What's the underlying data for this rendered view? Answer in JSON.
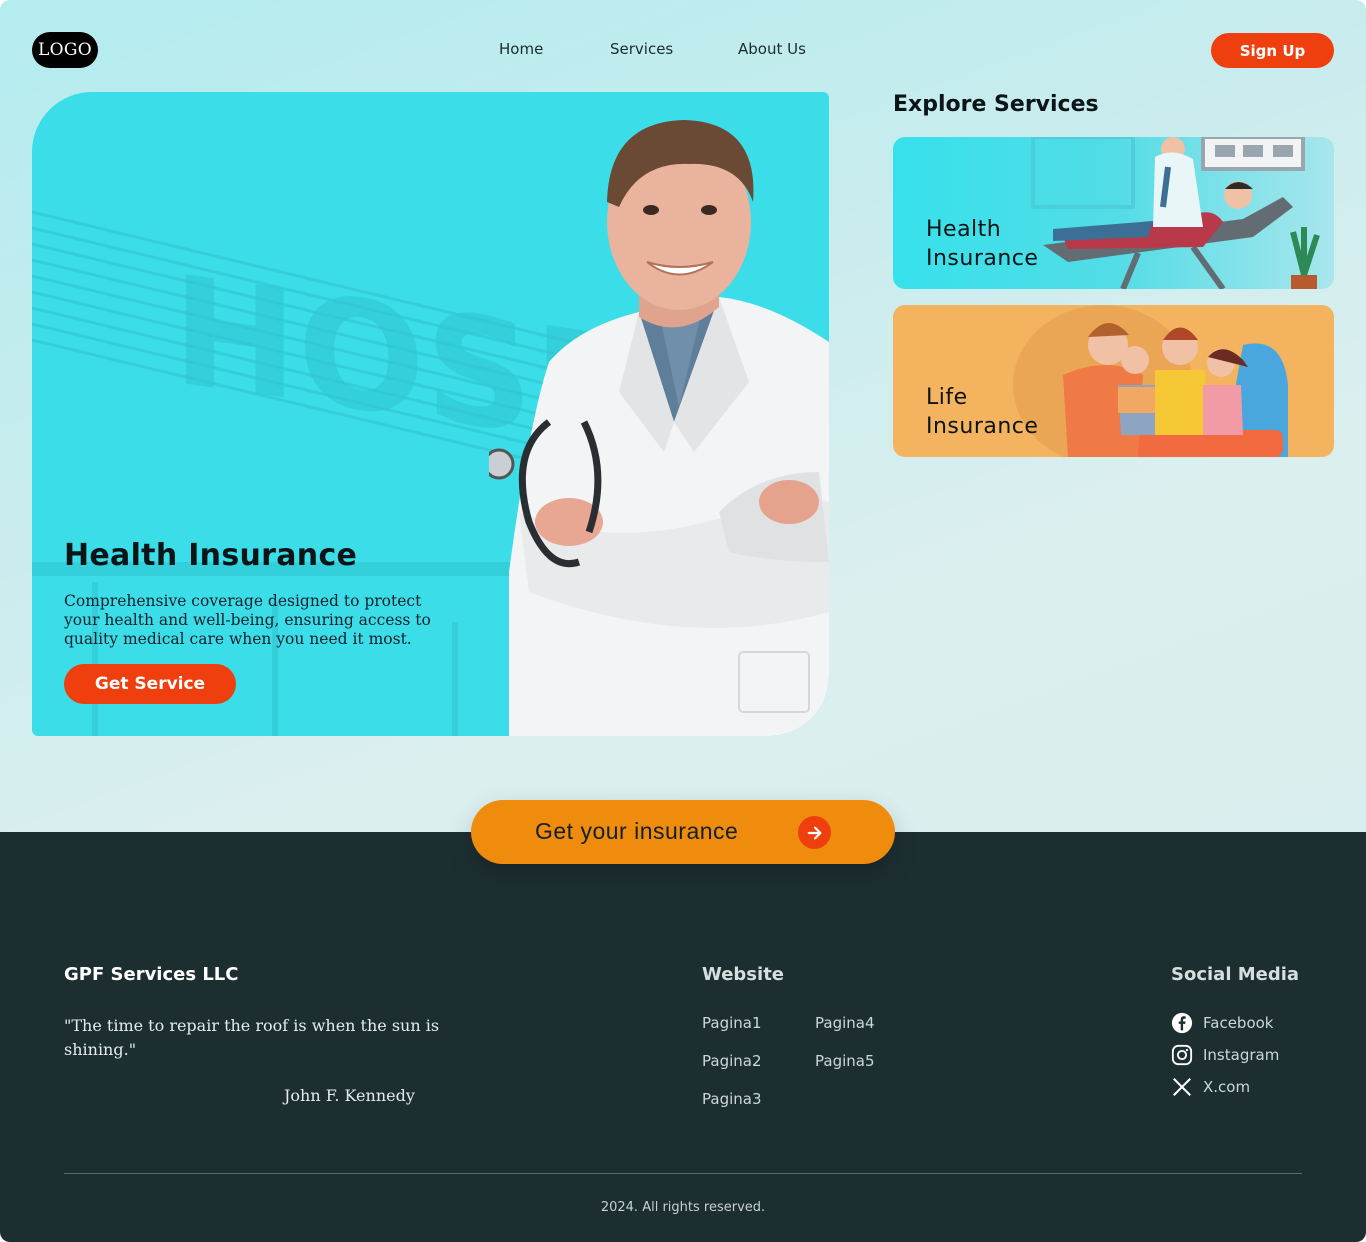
{
  "header": {
    "logo": "LOGO",
    "nav": [
      {
        "label": "Home"
      },
      {
        "label": "Services"
      },
      {
        "label": "About Us"
      }
    ],
    "signup_label": "Sign Up"
  },
  "hero": {
    "title": "Health Insurance",
    "description": "Comprehensive coverage designed to protect your health and well-being, ensuring access to quality medical care when you need it most.",
    "button_label": "Get Service",
    "background_text": "HOSP"
  },
  "explore": {
    "title": "Explore Services",
    "cards": [
      {
        "label": "Health Insurance",
        "icon": "patient-doctor-illustration"
      },
      {
        "label": "Life Insurance",
        "icon": "family-illustration"
      }
    ]
  },
  "cta": {
    "label": "Get your insurance",
    "icon": "arrow-right-icon"
  },
  "footer": {
    "company": "GPF Services LLC",
    "quote": "\"The time to repair the roof is when the sun is shining.\"",
    "author": "John F. Kennedy",
    "website_title": "Website",
    "website_links": [
      "Pagina1",
      "Pagina2",
      "Pagina3",
      "Pagina4",
      "Pagina5"
    ],
    "social_title": "Social Media",
    "social_links": [
      {
        "label": "Facebook",
        "icon": "facebook-icon"
      },
      {
        "label": "Instagram",
        "icon": "instagram-icon"
      },
      {
        "label": "X.com",
        "icon": "x-icon"
      }
    ],
    "copyright": "2024. All rights reserved."
  },
  "colors": {
    "accent_red": "#ef3f0f",
    "accent_orange": "#ef8c0e",
    "hero_cyan": "#3adde8",
    "footer_bg": "#1d2e31",
    "life_card": "#f4b45f"
  }
}
